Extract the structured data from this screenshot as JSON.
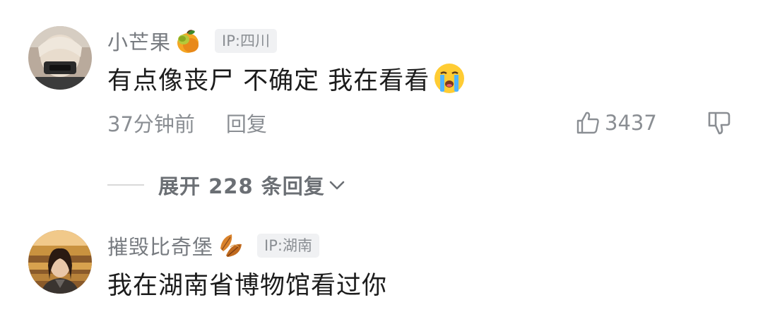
{
  "comments": [
    {
      "username": "小芒果",
      "name_emoji": "mango-emoji",
      "ip": "IP:四川",
      "text": "有点像丧尸 不确定 我在看看",
      "text_emoji": "loudly-crying-face-emoji",
      "time": "37分钟前",
      "reply_label": "回复",
      "likes": "3437"
    },
    {
      "username": "摧毁比奇堡",
      "name_emoji": "autumn-leaves-emoji",
      "ip": "IP:湖南",
      "text": "我在湖南省博物馆看过你"
    }
  ],
  "expand": {
    "label": "展开 228 条回复"
  },
  "colors": {
    "meta_gray": "#8a8e93",
    "badge_bg": "#f0f1f3",
    "text": "#1c1c1c"
  }
}
